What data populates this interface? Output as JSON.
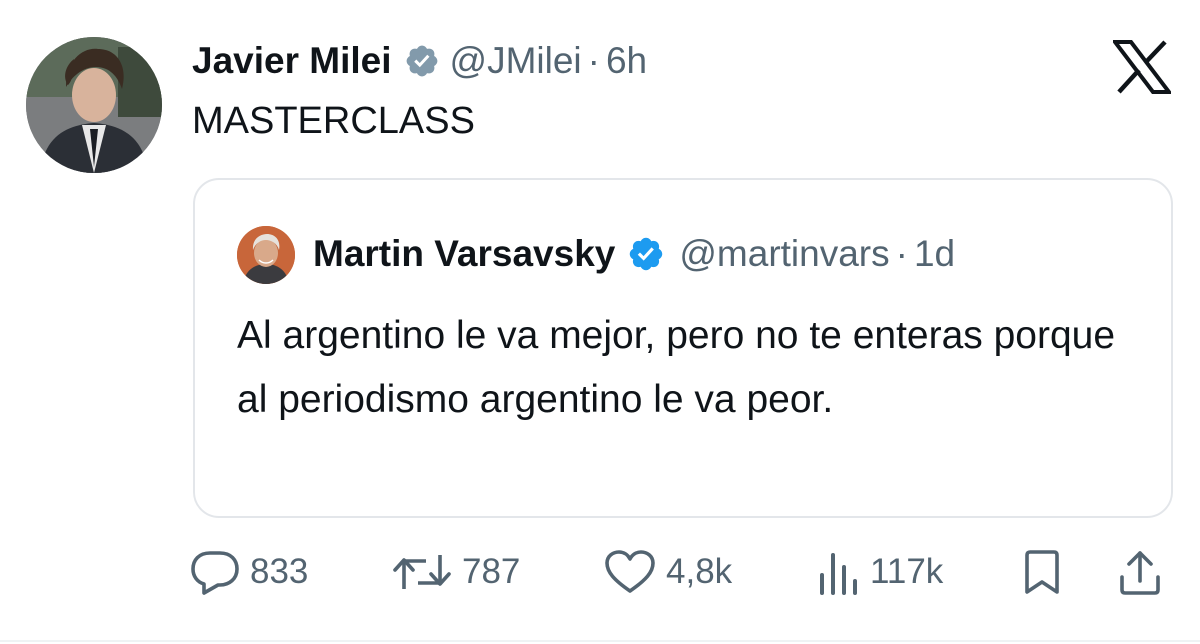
{
  "tweet": {
    "author_name": "Javier Milei",
    "author_handle": "@JMilei",
    "separator": "·",
    "time": "6h",
    "text": "MASTERCLASS",
    "verified_color": "#829aab"
  },
  "quoted_tweet": {
    "author_name": "Martin Varsavsky",
    "author_handle": "@martinvars",
    "separator": "·",
    "time": "1d",
    "text": "Al argentino le va mejor, pero no te enteras porque al periodismo argentino le va peor.",
    "verified_color": "#1d9bf0"
  },
  "actions": {
    "replies": "833",
    "reposts": "787",
    "likes": "4,8k",
    "views": "117k"
  },
  "icons": {
    "logo": "x-logo-icon",
    "reply": "reply-icon",
    "repost": "repost-icon",
    "like": "heart-icon",
    "views": "views-icon",
    "bookmark": "bookmark-icon",
    "share": "share-icon"
  },
  "colors": {
    "text_primary": "#0f1419",
    "text_secondary": "#536471",
    "border": "#e3e6ea"
  }
}
